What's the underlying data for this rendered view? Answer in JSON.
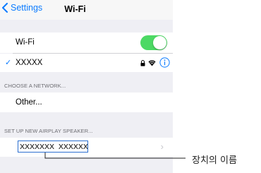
{
  "navbar": {
    "back_label": "Settings",
    "title": "Wi-Fi"
  },
  "wifi_row": {
    "label": "Wi-Fi",
    "toggle_on": true
  },
  "connected_row": {
    "network_name": "XXXXX"
  },
  "choose_section": {
    "header": "CHOOSE A NETWORK...",
    "other_label": "Other..."
  },
  "airplay_section": {
    "header": "SET UP NEW AIRPLAY SPEAKER...",
    "device_name": "XXXXXXX  XXXXXX"
  },
  "callout": {
    "label": "장치의 이름"
  },
  "colors": {
    "accent": "#0b7bff",
    "toggle": "#4cd964",
    "highlight": "#2c6fd0"
  }
}
